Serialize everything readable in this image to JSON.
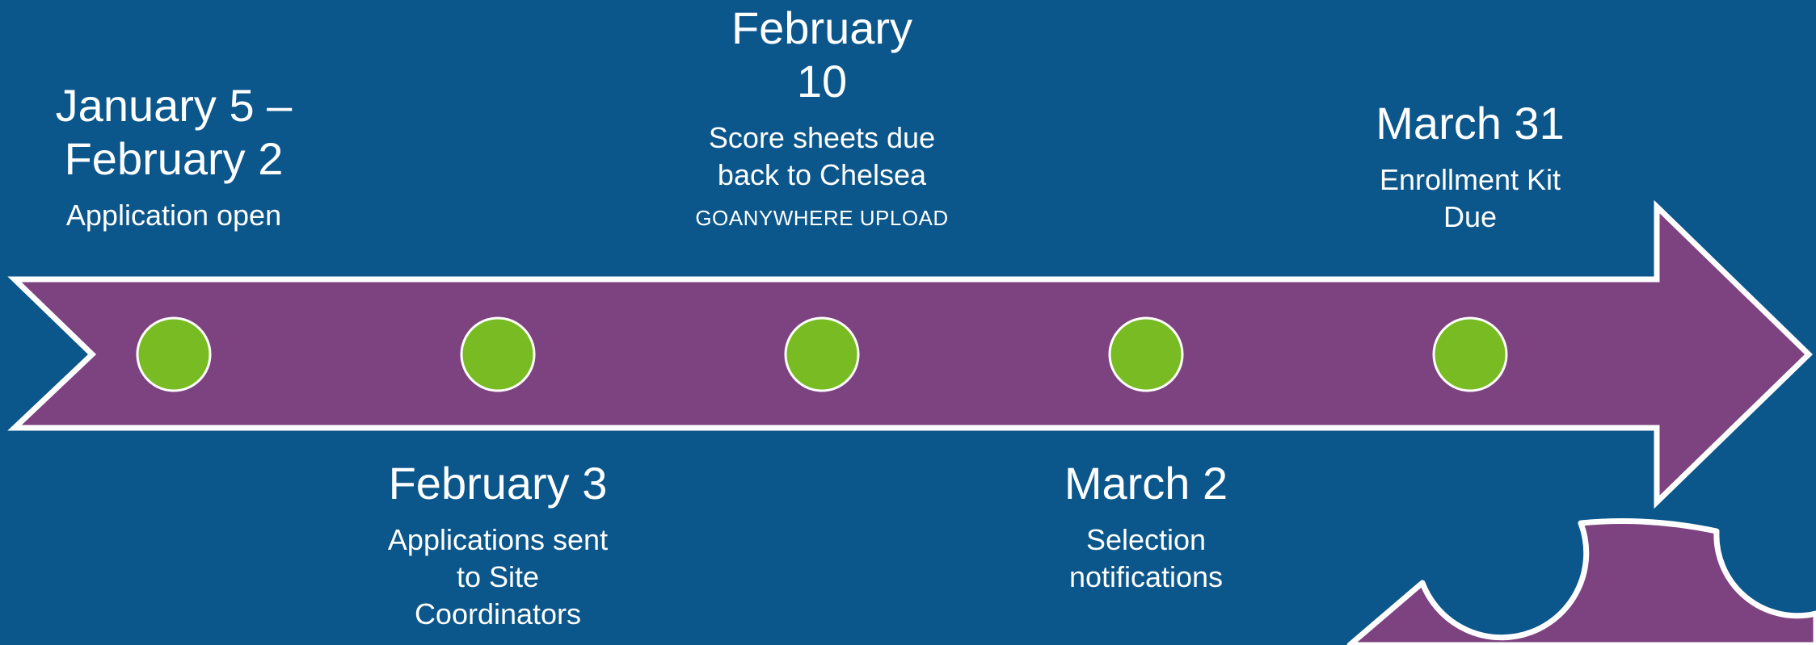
{
  "colors": {
    "background": "#0b568b",
    "arrow_fill": "#7d4381",
    "arrow_outline": "#ffffff",
    "milestone_dot": "#78bb22"
  },
  "events": [
    {
      "date": "January 5 –\nFebruary 2",
      "description": "Application open",
      "note": ""
    },
    {
      "date": "February 3",
      "description": "Applications sent\nto Site\nCoordinators",
      "note": ""
    },
    {
      "date": "February\n10",
      "description": "Score sheets due\nback to Chelsea",
      "note": "GOANYWHERE UPLOAD"
    },
    {
      "date": "March 2",
      "description": "Selection\nnotifications",
      "note": ""
    },
    {
      "date": "March 31",
      "description": "Enrollment Kit\nDue",
      "note": ""
    }
  ]
}
